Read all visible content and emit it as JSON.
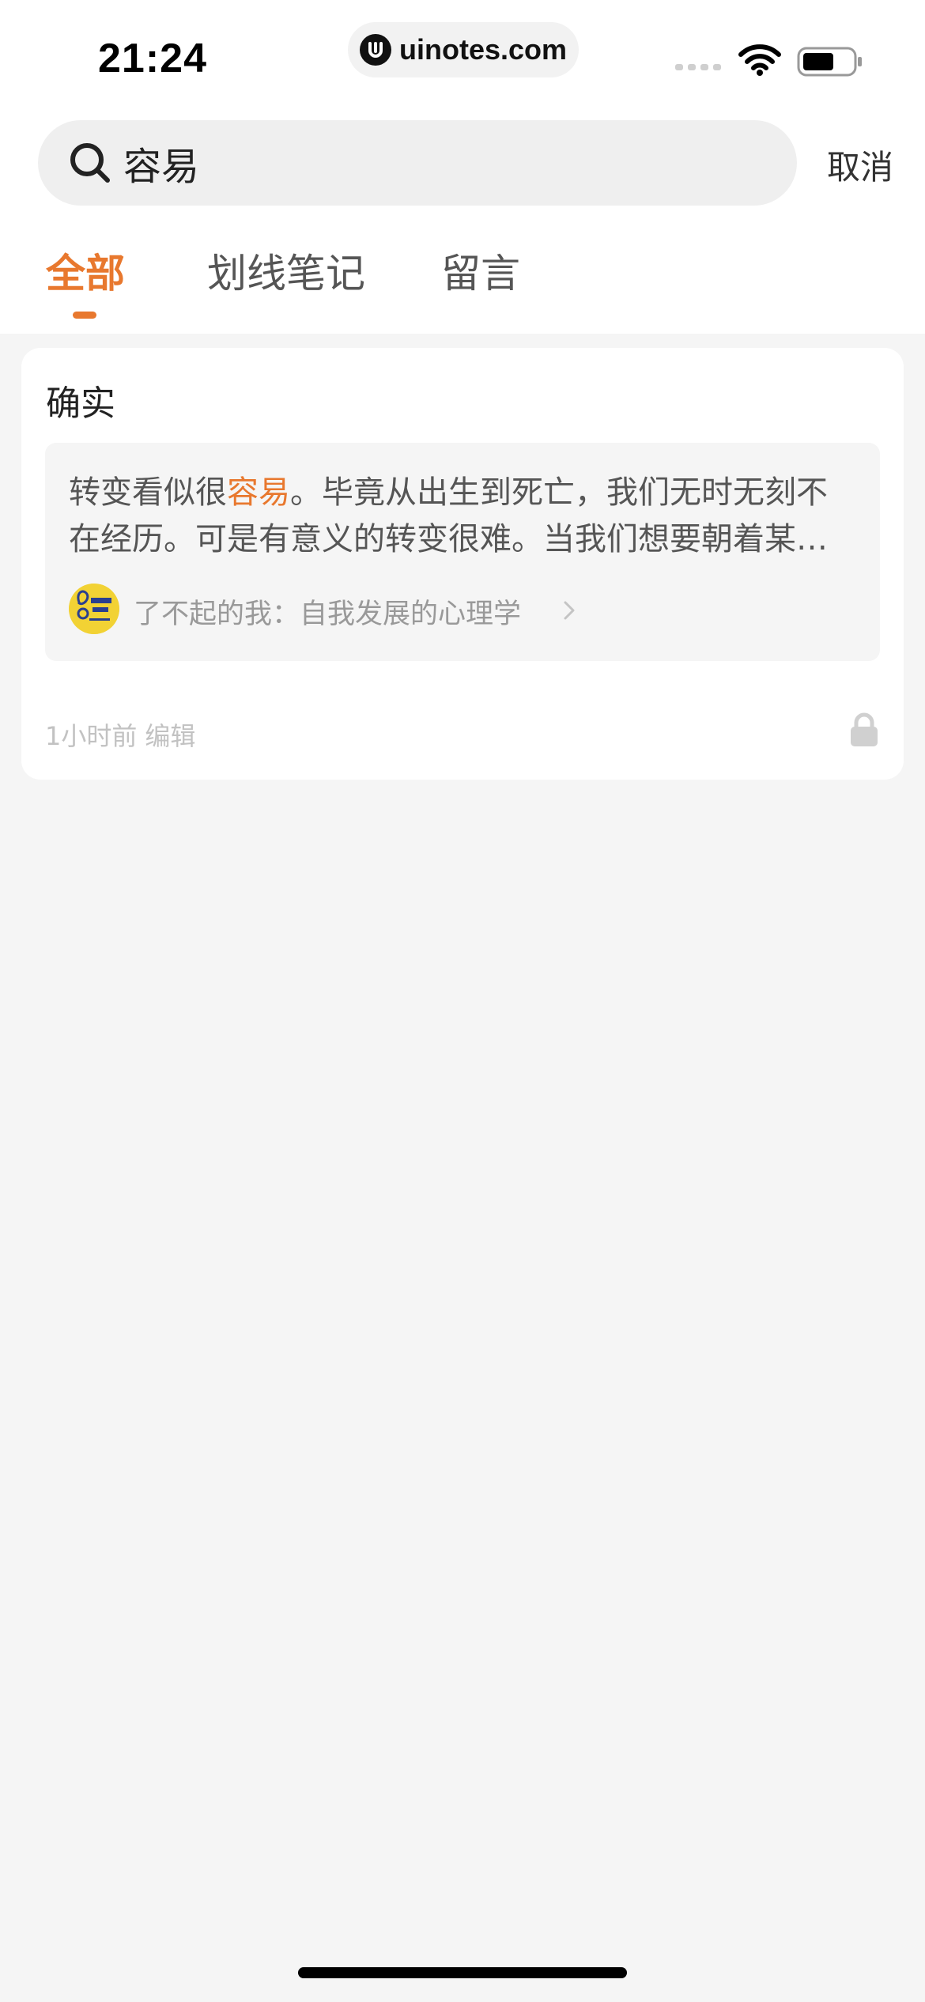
{
  "status_bar": {
    "time": "21:24",
    "watermark": "uinotes.com",
    "icons": [
      "cellular-signal-icon",
      "wifi-icon",
      "battery-icon"
    ]
  },
  "search": {
    "query": "容易",
    "icon": "search-icon",
    "cancel_label": "取消"
  },
  "tabs": [
    {
      "label": "全部",
      "active": true
    },
    {
      "label": "划线笔记",
      "active": false
    },
    {
      "label": "留言",
      "active": false
    }
  ],
  "results": [
    {
      "note": "确实",
      "quote_before": "转变看似很",
      "quote_highlight": "容易",
      "quote_after": "。毕竟从出生到死亡，我们无时无刻不在经历。可是有意义的转变很难。当我们想要朝着某个方向改变的时候……",
      "book_title": "了不起的我：自我发展的心理学",
      "time": "1小时前",
      "action": "编辑",
      "private": true
    }
  ],
  "colors": {
    "accent": "#e8782e",
    "background": "#f5f5f5",
    "card": "#ffffff"
  }
}
